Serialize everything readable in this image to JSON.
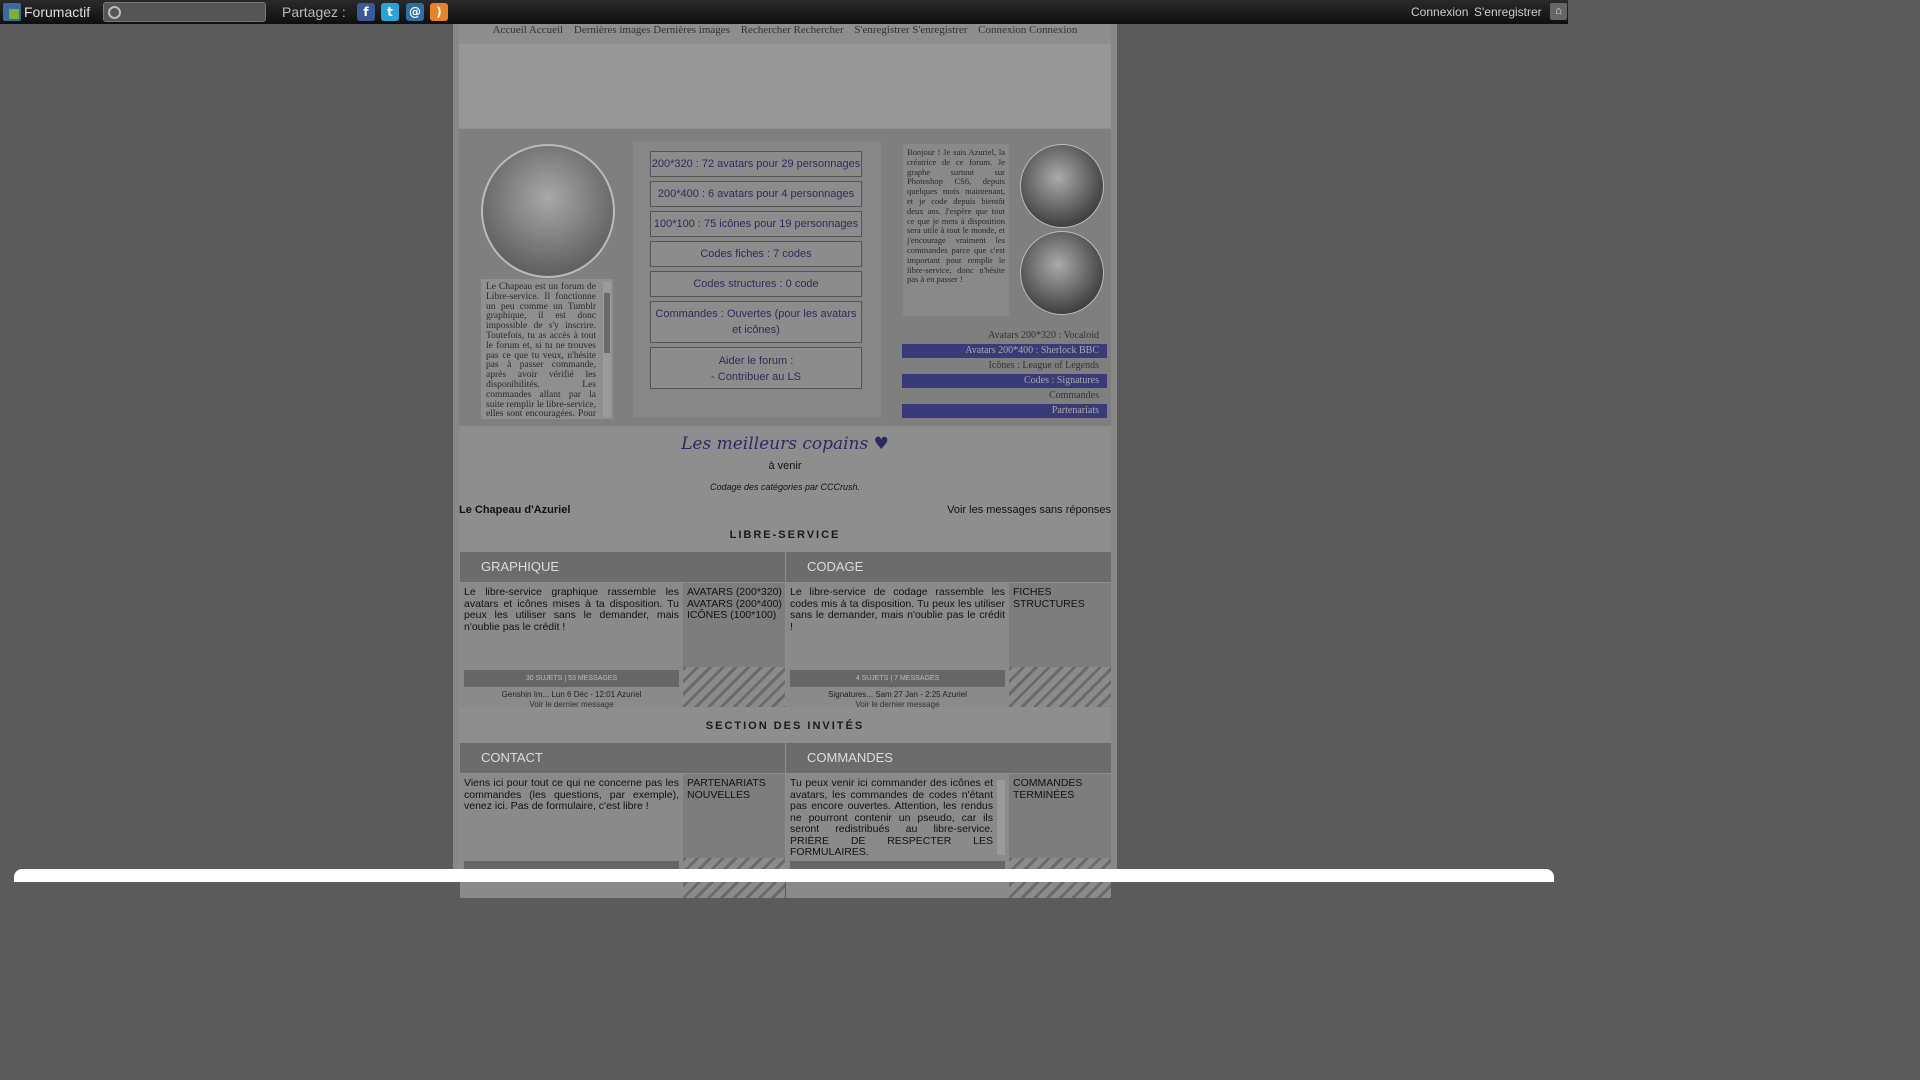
{
  "toolbar": {
    "brand": "Forumactif",
    "search_placeholder": "",
    "share_label": "Partagez :",
    "share_icons": [
      "facebook-icon",
      "twitter-icon",
      "email-icon",
      "rss-icon"
    ],
    "login": "Connexion",
    "register": "S'enregistrer"
  },
  "topnav": [
    "Accueil Accueil",
    "Dernières images Dernières images",
    "Rechercher Rechercher",
    "S'enregistrer S'enregistrer",
    "Connexion Connexion"
  ],
  "header": {
    "intro": "Le Chapeau est un forum de Libre-service. Il fonctionne un peu comme un Tumblr graphique, il est donc impossible de s'y inscrire. Toutefois, tu as accès à tout le forum et, si tu ne trouves pas ce que tu veux, n'hésite pas à passer commande, après avoir vérifié les disponibilités. Les commandes allant par la suite remplir le libre-service, elles sont encouragées. Pour toute question, n'hésite pas à aller",
    "pills": [
      "200*320 : 72 avatars pour 29 personnages",
      "200*400 : 6 avatars pour 4 personnages",
      "100*100 : 75 icônes pour 19 personnages",
      "Codes fiches : 7 codes",
      "Codes structures : 0 code",
      "Commandes : Ouvertes (pour les avatars et icônes)",
      "Aider le forum :\n- Contribuer au LS"
    ],
    "side_text": "Bonjour ! Je suis Azuriel, la créatrice de ce forum. Je graphe surtout sur Photoshop CS6, depuis quelques mois maintenant, et je code depuis bientôt deux ans. J'espère que tout ce que je mets à disposition sera utile à tout le monde, et j'encourage vraiment les commandes parce que c'est important pour remplir le libre-service, donc n'hésite pas à en passer !",
    "catlinks": [
      "Avatars 200*320 : Vocaloid",
      "Avatars 200*400 : Sherlock BBC",
      "Icônes : League of Legends",
      "Codes : Signatures",
      "Commandes",
      "Partenariats"
    ]
  },
  "main": {
    "best_friends": "Les meilleurs copains ♥",
    "coming": "à venir",
    "credit": "Codage des catégories par CCCrush.",
    "forum_title": "Le Chapeau d'Azuriel",
    "unanswered": "Voir les messages sans réponses",
    "sections": [
      {
        "title": "LIBRE-SERVICE",
        "categories": [
          {
            "name": "GRAPHIQUE",
            "desc": "Le libre-service graphique rassemble les avatars et icônes mises à ta disposition. Tu peux les utiliser sans le demander, mais n'oublie pas le crédit !",
            "subs": [
              "AVATARS (200*320)",
              "AVATARS (200*400)",
              "ICÔNES (100*100)"
            ],
            "stats": "30 SUJETS | 53 MESSAGES",
            "last": "Genshin Im...   Lun 6 Déc - 12:01 Azuriel",
            "last2": "Voir le dernier message"
          },
          {
            "name": "CODAGE",
            "desc": "Le libre-service de codage rassemble les codes mis à ta disposition. Tu peux les utiliser sans le demander, mais n'oublie pas le crédit !",
            "subs": [
              "FICHES",
              "STRUCTURES"
            ],
            "stats": "4 SUJETS | 7 MESSAGES",
            "last": "Signatures...   Sam 27 Jan - 2:25 Azuriel",
            "last2": "Voir le dernier message"
          }
        ]
      },
      {
        "title": "SECTION DES INVITÉS",
        "categories": [
          {
            "name": "CONTACT",
            "desc": "Viens ici pour tout ce qui ne concerne pas les commandes (les questions, par exemple), venez ici. Pas de formulaire, c'est libre !",
            "subs": [
              "PARTENARIATS",
              "NOUVELLES"
            ]
          },
          {
            "name": "COMMANDES",
            "desc": "Tu peux venir ici commander des icônes et avatars, les commandes de codes n'étant pas encore ouvertes. Attention, les rendus ne pourront contenir un pseudo, car ils seront redistribués au libre-service. PRIÈRE DE RESPECTER LES FORMULAIRES.",
            "subs": [
              "COMMANDES",
              "TERMINÉES"
            ]
          }
        ]
      }
    ]
  }
}
